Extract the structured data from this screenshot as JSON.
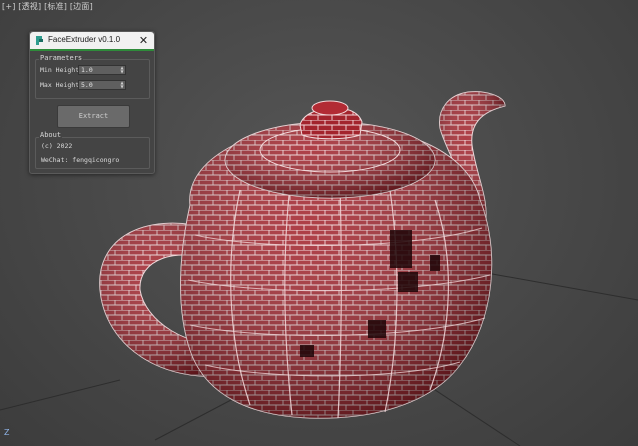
{
  "viewport": {
    "label": "[+] [透视] [标准] [边面]",
    "axis_label": "Z",
    "mesh_color": "#b42a33",
    "wire_color": "#f2d6d8",
    "background": "#4a4a4a"
  },
  "panel": {
    "title": "FaceExtruder v0.1.0",
    "close_label": "✕",
    "parameters": {
      "title": "Parameters",
      "min_height_label": "Min Height",
      "min_height_value": "1.0",
      "max_height_label": "Max Height",
      "max_height_value": "5.0"
    },
    "extract_label": "Extract",
    "about": {
      "title": "About",
      "copyright": "(c) 2022",
      "wechat": "WeChat: fengqicongro"
    }
  }
}
